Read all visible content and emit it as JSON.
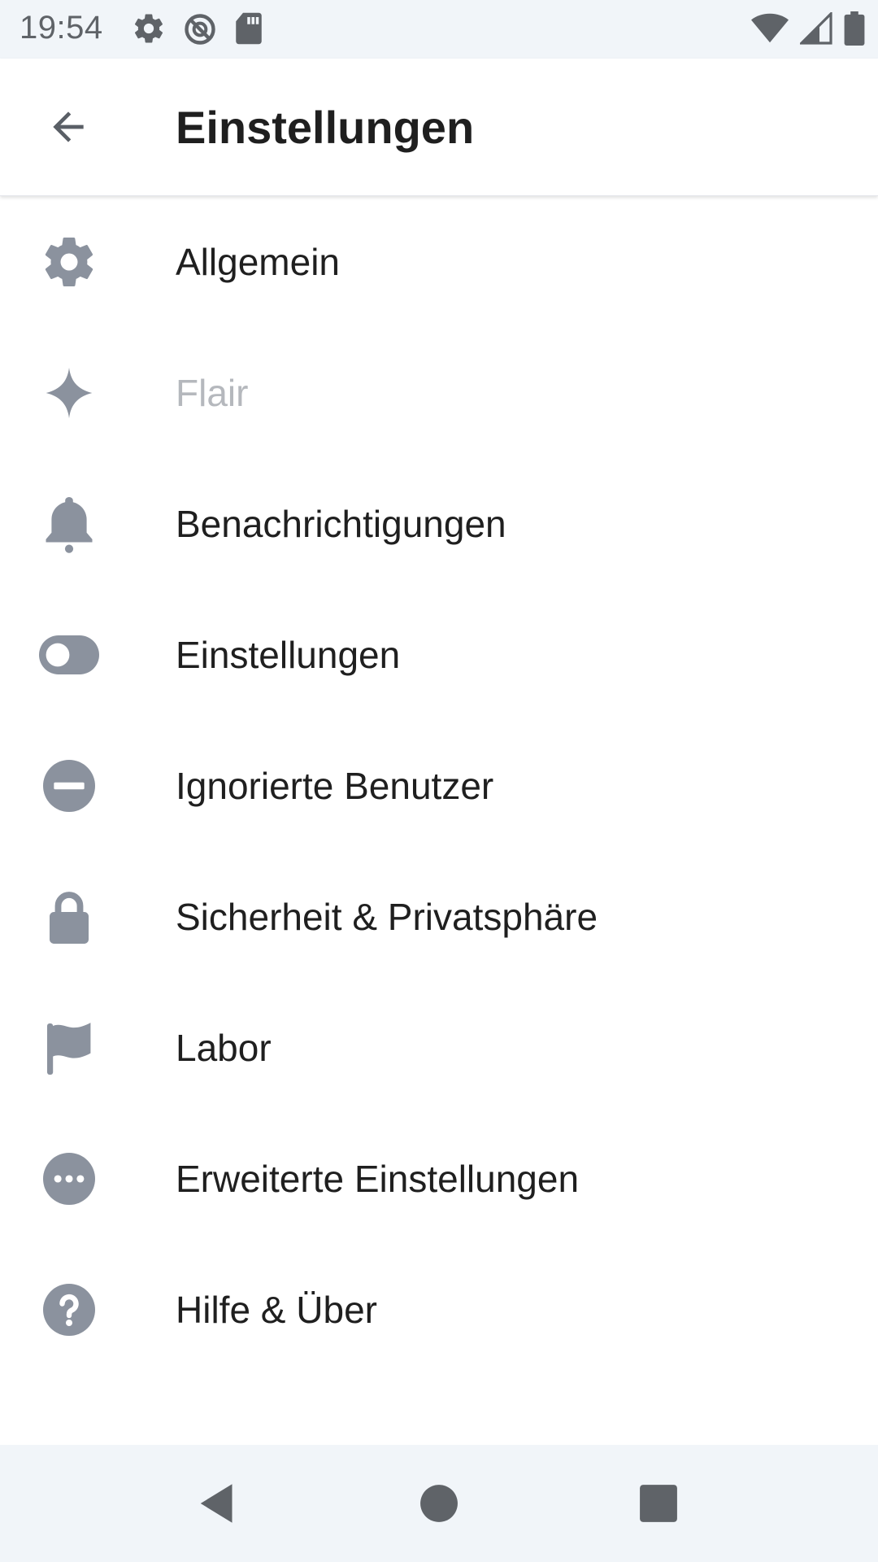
{
  "status_bar": {
    "time": "19:54",
    "icons_left": [
      "settings-icon",
      "do-not-disturb-icon",
      "sd-card-icon"
    ],
    "icons_right": [
      "wifi-icon",
      "cell-signal-icon",
      "battery-icon"
    ]
  },
  "app_bar": {
    "back_icon": "arrow-back-icon",
    "title": "Einstellungen"
  },
  "menu": {
    "items": [
      {
        "label": "Allgemein",
        "icon": "gear-icon",
        "enabled": true
      },
      {
        "label": "Flair",
        "icon": "sparkle-icon",
        "enabled": false
      },
      {
        "label": "Benachrichtigungen",
        "icon": "bell-icon",
        "enabled": true
      },
      {
        "label": "Einstellungen",
        "icon": "toggle-icon",
        "enabled": true
      },
      {
        "label": "Ignorierte Benutzer",
        "icon": "block-icon",
        "enabled": true
      },
      {
        "label": "Sicherheit & Privatsphäre",
        "icon": "lock-icon",
        "enabled": true
      },
      {
        "label": "Labor",
        "icon": "flag-icon",
        "enabled": true
      },
      {
        "label": "Erweiterte Einstellungen",
        "icon": "more-icon",
        "enabled": true
      },
      {
        "label": "Hilfe & Über",
        "icon": "help-icon",
        "enabled": true
      }
    ]
  },
  "nav_bar": {
    "buttons": [
      "nav-back-icon",
      "nav-home-icon",
      "nav-recents-icon"
    ]
  },
  "colors": {
    "icon": "#8b929e",
    "text": "#1f1f1f",
    "disabled_text": "#b5b8bd",
    "bar_background": "#f1f5f9"
  }
}
